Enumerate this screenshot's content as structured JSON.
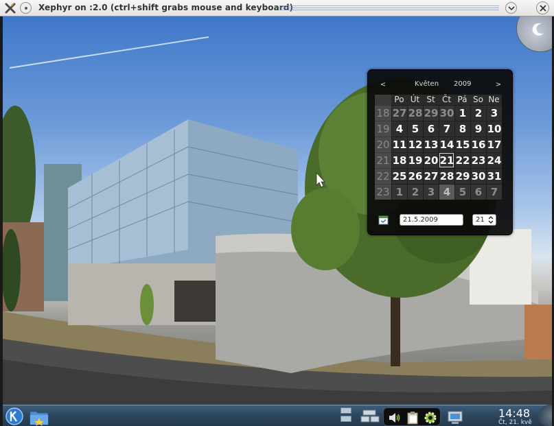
{
  "window": {
    "title": "Xephyr on :2.0 (ctrl+shift grabs mouse and keyboard)"
  },
  "calendar": {
    "prev_label": "<",
    "next_label": ">",
    "month": "Květen",
    "year": "2009",
    "weekday_headers": [
      "Po",
      "Út",
      "St",
      "Čt",
      "Pá",
      "So",
      "Ne"
    ],
    "weeks": [
      {
        "week": "18",
        "days": [
          {
            "d": "27",
            "other": true
          },
          {
            "d": "28",
            "other": true
          },
          {
            "d": "29",
            "other": true
          },
          {
            "d": "30",
            "other": true
          },
          {
            "d": "1"
          },
          {
            "d": "2"
          },
          {
            "d": "3"
          }
        ]
      },
      {
        "week": "19",
        "days": [
          {
            "d": "4"
          },
          {
            "d": "5"
          },
          {
            "d": "6"
          },
          {
            "d": "7"
          },
          {
            "d": "8"
          },
          {
            "d": "9"
          },
          {
            "d": "10"
          }
        ]
      },
      {
        "week": "20",
        "days": [
          {
            "d": "11"
          },
          {
            "d": "12"
          },
          {
            "d": "13"
          },
          {
            "d": "14"
          },
          {
            "d": "15"
          },
          {
            "d": "16"
          },
          {
            "d": "17"
          }
        ]
      },
      {
        "week": "21",
        "days": [
          {
            "d": "18"
          },
          {
            "d": "19"
          },
          {
            "d": "20"
          },
          {
            "d": "21",
            "today": true
          },
          {
            "d": "22"
          },
          {
            "d": "23"
          },
          {
            "d": "24"
          }
        ]
      },
      {
        "week": "22",
        "days": [
          {
            "d": "25"
          },
          {
            "d": "26"
          },
          {
            "d": "27"
          },
          {
            "d": "28"
          },
          {
            "d": "29"
          },
          {
            "d": "30"
          },
          {
            "d": "31"
          }
        ]
      },
      {
        "week": "23",
        "days": [
          {
            "d": "1",
            "other": true
          },
          {
            "d": "2",
            "other": true
          },
          {
            "d": "3",
            "other": true
          },
          {
            "d": "4",
            "other": true,
            "sel": true
          },
          {
            "d": "5",
            "other": true
          },
          {
            "d": "6",
            "other": true
          },
          {
            "d": "7",
            "other": true
          }
        ]
      }
    ],
    "date_value": "21.5.2009",
    "week_value": "21"
  },
  "panel": {
    "clock_time": "14:48",
    "clock_date": "Čt, 21. kvě",
    "icons": [
      "kde-menu-icon",
      "folder-icon",
      "pager-icon",
      "taskmanager-icon",
      "volume-icon",
      "clipboard-icon",
      "settings-icon",
      "network-icon"
    ]
  },
  "colors": {
    "panel": "#2f4a63",
    "calendar_bg": "#0a0a0a"
  }
}
